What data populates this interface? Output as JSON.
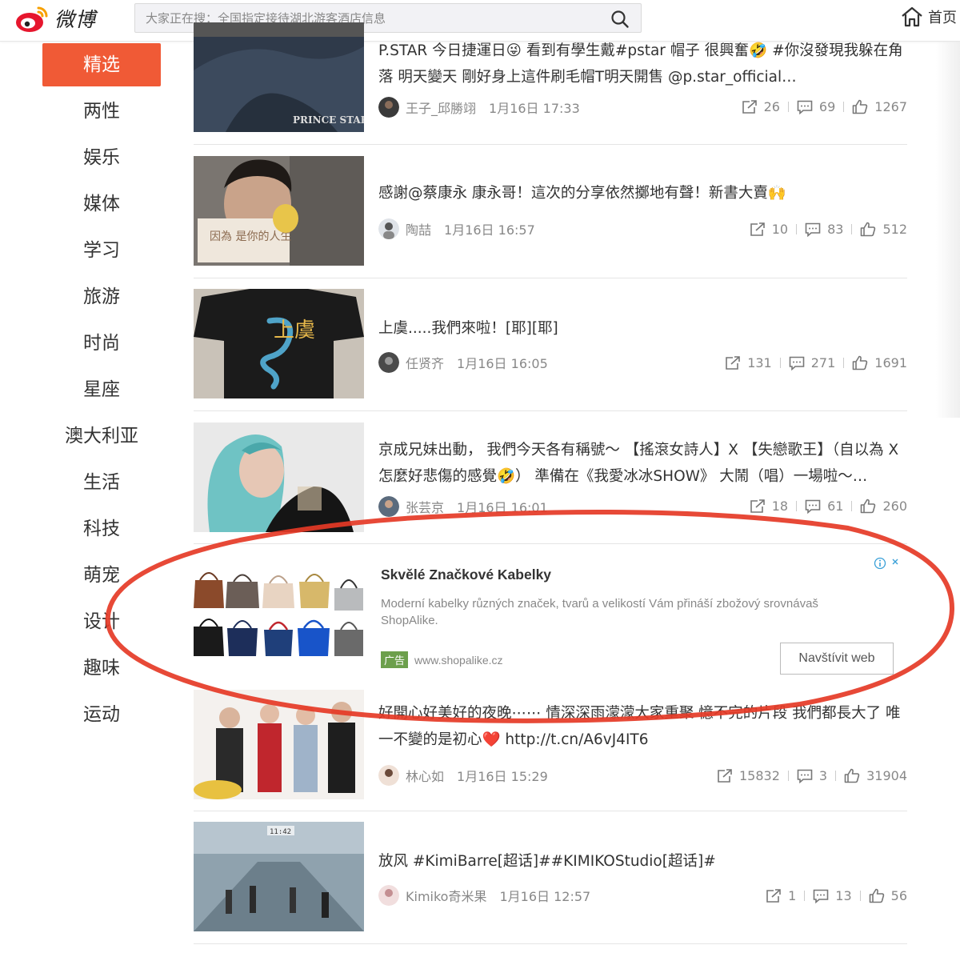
{
  "header": {
    "logo_text": "微博",
    "search_placeholder": "大家正在搜：全国指定接待湖北游客酒店信息",
    "home_label": "首页"
  },
  "sidebar": {
    "items": [
      {
        "label": "精选",
        "active": true
      },
      {
        "label": "两性"
      },
      {
        "label": "娱乐"
      },
      {
        "label": "媒体"
      },
      {
        "label": "学习"
      },
      {
        "label": "旅游"
      },
      {
        "label": "时尚"
      },
      {
        "label": "星座"
      },
      {
        "label": "澳大利亚"
      },
      {
        "label": "生活"
      },
      {
        "label": "科技"
      },
      {
        "label": "萌宠"
      },
      {
        "label": "设计"
      },
      {
        "label": "趣味"
      },
      {
        "label": "运动"
      }
    ]
  },
  "feed": [
    {
      "title": "P.STAR 今日捷運日😜 看到有學生戴#pstar 帽子 很興奮🤣 #你沒發現我躲在角落 明天變天 剛好身上這件刷毛帽T明天開售 @p.star_official…",
      "author": "王子_邱勝翊",
      "time": "1月16日 17:33",
      "reposts": "26",
      "comments": "69",
      "likes": "1267",
      "thumb_text": "PRINCE STAR"
    },
    {
      "title": "感謝@蔡康永 康永哥！這次的分享依然擲地有聲！新書大賣🙌",
      "author": "陶喆",
      "time": "1月16日 16:57",
      "reposts": "10",
      "comments": "83",
      "likes": "512",
      "thumb_text": "因為 是你的人生"
    },
    {
      "title": "上虞.....我們來啦！[耶][耶]",
      "author": "任贤齐",
      "time": "1月16日 16:05",
      "reposts": "131",
      "comments": "271",
      "likes": "1691",
      "thumb_text": "上虞"
    },
    {
      "title": "京成兄妹出動， 我們今天各有稱號～ 【搖滾女詩人】X 【失戀歌王】（自以為 X 怎麼好悲傷的感覺🤣） 準備在《我愛冰冰SHOW》 大鬧（唱）一場啦～…",
      "author": "张芸京",
      "time": "1月16日 16:01",
      "reposts": "18",
      "comments": "61",
      "likes": "260"
    },
    {
      "title": "好開心好美好的夜晚⋯⋯ 情深深雨濛濛大家重聚 憶不完的片段 我們都長大了 唯一不變的是初心❤️ http://t.cn/A6vJ4IT6",
      "author": "林心如",
      "time": "1月16日 15:29",
      "reposts": "15832",
      "comments": "3",
      "likes": "31904"
    },
    {
      "title": "放风 #KimiBarre[超话]##KIMIKOStudio[超话]#",
      "author": "Kimiko奇米果",
      "time": "1月16日 12:57",
      "reposts": "1",
      "comments": "13",
      "likes": "56",
      "thumb_text": "11:42"
    }
  ],
  "ad": {
    "title": "Skvělé Značkové Kabelky",
    "description": "Moderní kabelky různých značek, tvarů a velikostí Vám přináší zbožový srovnávaš ShopAlike.",
    "tag": "广告",
    "url": "www.shopalike.cz",
    "button_label": "Navštívit web"
  },
  "colors": {
    "accent": "#f05a36",
    "annotation": "#e53a26",
    "ad_tag": "#6c9f4c"
  }
}
